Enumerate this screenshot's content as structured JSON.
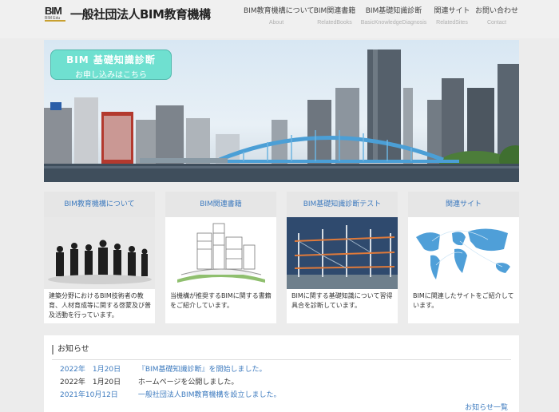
{
  "header": {
    "logo_text": "BIM",
    "logo_sub": "BIM Edu",
    "site_title": "一般社団法人BIM教育機構",
    "nav": [
      {
        "label": "BIM教育機構について",
        "sub": "About"
      },
      {
        "label": "BIM関連書籍",
        "sub": "RelatedBooks"
      },
      {
        "label": "BIM基礎知識診断",
        "sub": "BasicKnowledgeDiagnosis"
      },
      {
        "label": "関連サイト",
        "sub": "RelatedSites"
      },
      {
        "label": "お問い合わせ",
        "sub": "Contact"
      }
    ]
  },
  "hero": {
    "promo_title": "BIM 基礎知識診断",
    "promo_sub": "お申し込みはこちら"
  },
  "cards": [
    {
      "title": "BIM教育機構について",
      "desc": "建築分野におけるBIM技術者の教育、人材育成等に関する啓蒙及び普及活動を行っています。"
    },
    {
      "title": "BIM関連書籍",
      "desc": "当機構が推奨するBIMに関する書籍をご紹介しています。"
    },
    {
      "title": "BIM基礎知識診断テスト",
      "desc": "BIMに関する基礎知識について習得具合を診断しています。"
    },
    {
      "title": "関連サイト",
      "desc": "BIMに関連したサイトをご紹介しています。"
    }
  ],
  "news": {
    "heading": "お知らせ",
    "items": [
      {
        "date": "2022年　1月20日",
        "text": "『BIM基礎知識診断』を開始しました。",
        "link": true
      },
      {
        "date": "2022年　1月20日",
        "text": "ホームページを公開しました。",
        "link": false
      },
      {
        "date": "2021年10月12日",
        "text": "一般社団法人BIM教育機構を設立しました。",
        "link": true
      }
    ],
    "more": "お知らせ一覧"
  },
  "colors": {
    "accent": "#3e7bbf",
    "promo": "#6fe0d0",
    "background": "#ececec"
  }
}
